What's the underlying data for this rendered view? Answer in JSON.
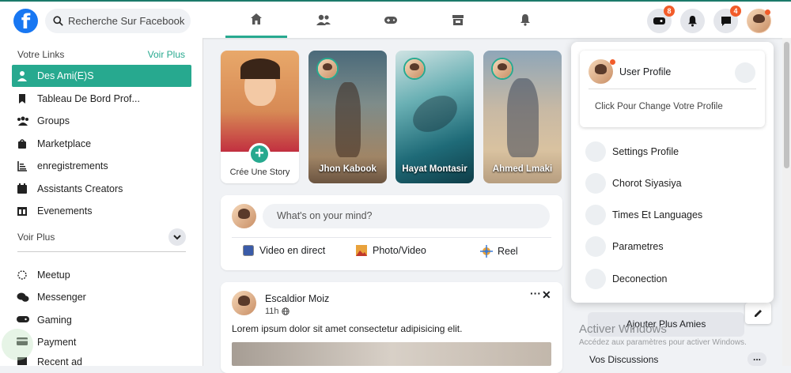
{
  "topbar": {
    "logo_letter": "f",
    "search_placeholder": "Recherche Sur Facebook",
    "nav_tabs": [
      "home-icon",
      "friends-icon",
      "gaming-icon",
      "marketplace-icon",
      "notifications-icon"
    ],
    "badges": {
      "games": "8",
      "messages": "4"
    }
  },
  "sidebar": {
    "links_heading": "Votre Links",
    "voir_plus_link": "Voir Plus",
    "items": [
      {
        "label": "Des Ami(E)S",
        "icon": "friend-icon",
        "active": true
      },
      {
        "label": "Tableau De Bord Prof...",
        "icon": "bookmark-icon"
      },
      {
        "label": "Groups",
        "icon": "groups-icon"
      },
      {
        "label": "Marketplace",
        "icon": "bag-icon"
      },
      {
        "label": "enregistrements",
        "icon": "chart-icon"
      },
      {
        "label": "Assistants Creators",
        "icon": "calendar-icon"
      },
      {
        "label": "Evenements",
        "icon": "events-icon"
      }
    ],
    "voir_plus_section": "Voir Plus",
    "items2": [
      {
        "label": "Meetup",
        "icon": "meetup-icon"
      },
      {
        "label": "Messenger",
        "icon": "messenger-icon"
      },
      {
        "label": "Gaming",
        "icon": "gamepad-icon"
      },
      {
        "label": "Payment",
        "icon": "payment-icon"
      },
      {
        "label": "Recent ad",
        "icon": "ad-icon"
      }
    ]
  },
  "stories": [
    {
      "label": "Crée Une Story",
      "type": "create"
    },
    {
      "label": "Jhon Kabook"
    },
    {
      "label": "Hayat Montasir"
    },
    {
      "label": "Ahmed Lmaki"
    }
  ],
  "composer": {
    "placeholder": "What's on your mind?",
    "actions": [
      "Video en direct",
      "Photo/Video",
      "Reel"
    ]
  },
  "post": {
    "author": "Escaldior Moiz",
    "time": "11h",
    "text": "Lorem ipsum dolor sit amet consectetur adipisicing elit."
  },
  "profile_menu": {
    "user_label": "User Profile",
    "change_label": "Click Pour Change Votre Profile",
    "items": [
      "Settings Profile",
      "Chorot Siyasiya",
      "Times Et Languages",
      "Parametres",
      "Deconection"
    ]
  },
  "right_panel": {
    "add_friends": "Ajouter Plus Amies",
    "discussions": "Vos Discussions",
    "more": "..."
  },
  "watermark": {
    "title": "Activer Windows",
    "subtitle": "Accédez aux paramètres pour activer Windows."
  },
  "colors": {
    "accent": "#27a98f",
    "brand": "#1877f2",
    "badge": "#f25c2a"
  }
}
